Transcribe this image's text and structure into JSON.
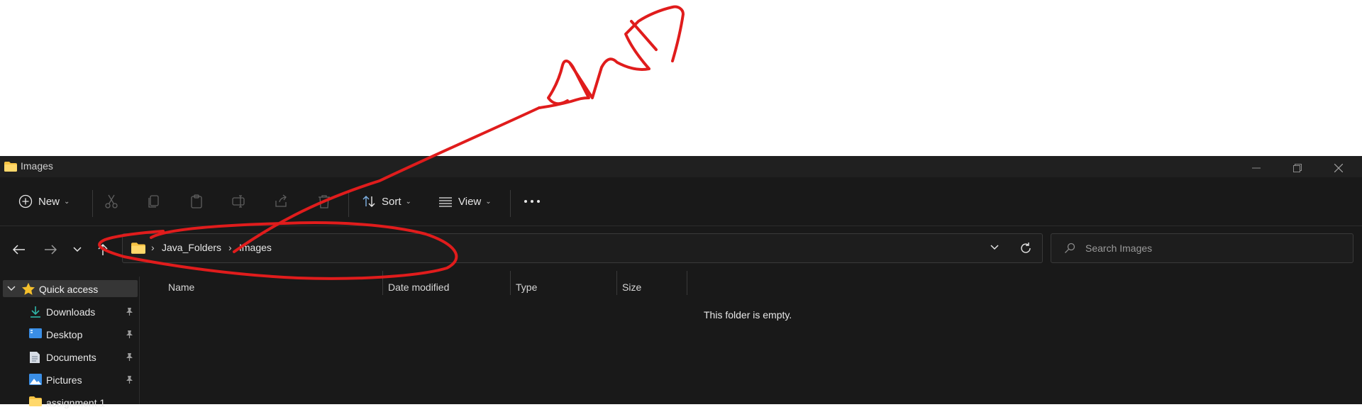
{
  "window": {
    "title": "Images"
  },
  "toolbar": {
    "new_label": "New",
    "sort_label": "Sort",
    "view_label": "View",
    "more_label": "···"
  },
  "address": {
    "crumbs": [
      "Java_Folders",
      "Images"
    ]
  },
  "search": {
    "placeholder": "Search Images"
  },
  "sidebar": {
    "quick_access": "Quick access",
    "items": [
      {
        "label": "Downloads",
        "icon": "download-icon"
      },
      {
        "label": "Desktop",
        "icon": "desktop-icon"
      },
      {
        "label": "Documents",
        "icon": "document-icon"
      },
      {
        "label": "Pictures",
        "icon": "pictures-icon"
      },
      {
        "label": "assignment 1",
        "icon": "folder-icon"
      }
    ]
  },
  "columns": [
    "Name",
    "Date modified",
    "Type",
    "Size"
  ],
  "content": {
    "empty_message": "This folder is empty."
  },
  "colors": {
    "window_bg": "#191919",
    "accent_red": "#e01c1c",
    "folder_yellow": "#f6c344"
  }
}
